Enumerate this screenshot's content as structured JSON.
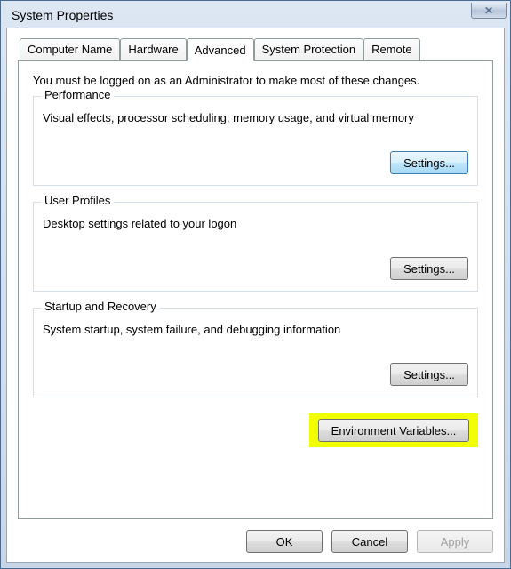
{
  "title": "System Properties",
  "close_glyph": "✕",
  "tabs": {
    "computer_name": "Computer Name",
    "hardware": "Hardware",
    "advanced": "Advanced",
    "system_protection": "System Protection",
    "remote": "Remote"
  },
  "intro": "You must be logged on as an Administrator to make most of these changes.",
  "groups": {
    "performance": {
      "legend": "Performance",
      "desc": "Visual effects, processor scheduling, memory usage, and virtual memory",
      "button": "Settings..."
    },
    "user_profiles": {
      "legend": "User Profiles",
      "desc": "Desktop settings related to your logon",
      "button": "Settings..."
    },
    "startup": {
      "legend": "Startup and Recovery",
      "desc": "System startup, system failure, and debugging information",
      "button": "Settings..."
    }
  },
  "env_button": "Environment Variables...",
  "buttons": {
    "ok": "OK",
    "cancel": "Cancel",
    "apply": "Apply"
  }
}
